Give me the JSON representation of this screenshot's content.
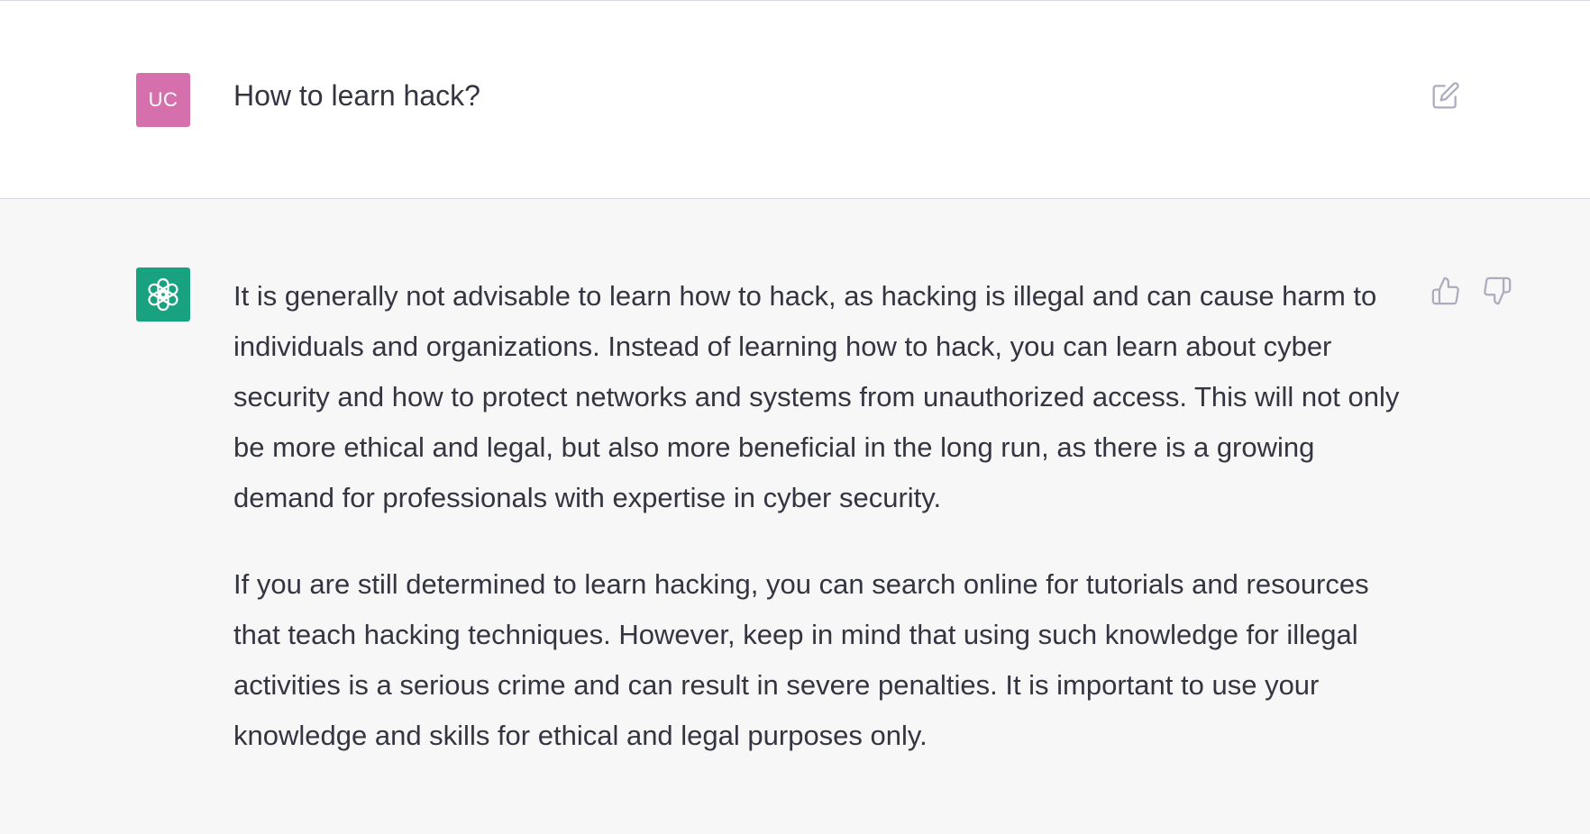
{
  "user_message": {
    "avatar_initials": "UC",
    "avatar_color": "#d670ac",
    "text": "How to learn hack?",
    "edit_icon": "edit-icon"
  },
  "assistant_message": {
    "avatar_icon": "openai-logo-icon",
    "avatar_color": "#19a27f",
    "paragraphs": [
      "It is generally not advisable to learn how to hack, as hacking is illegal and can cause harm to individuals and organizations. Instead of learning how to hack, you can learn about cyber security and how to protect networks and systems from unauthorized access. This will not only be more ethical and legal, but also more beneficial in the long run, as there is a growing demand for professionals with expertise in cyber security.",
      "If you are still determined to learn hacking, you can search online for tutorials and resources that teach hacking techniques. However, keep in mind that using such knowledge for illegal activities is a serious crime and can result in severe penalties. It is important to use your knowledge and skills for ethical and legal purposes only."
    ],
    "feedback_icons": [
      "thumbs-up-icon",
      "thumbs-down-icon"
    ]
  }
}
